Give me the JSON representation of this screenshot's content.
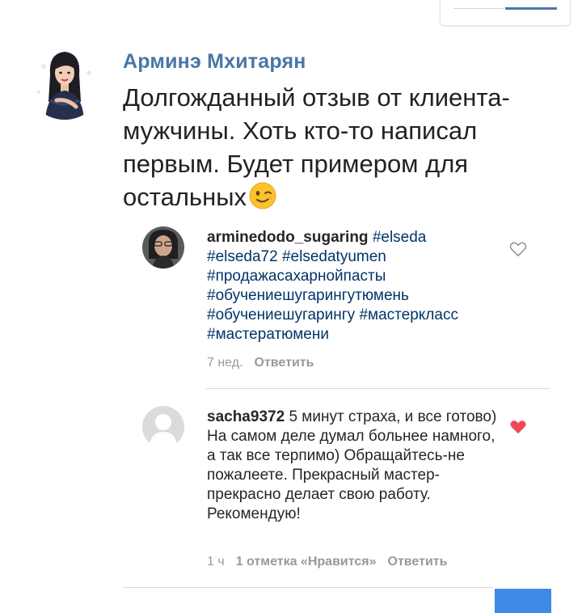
{
  "post": {
    "author": "Арминэ Мхитарян",
    "text": "Долгожданный отзыв от клиента-мужчины. Хоть кто-то написал первым. Будет примером для остальных",
    "emoji_icon": "winking-face-emoji"
  },
  "comments": [
    {
      "username": "arminedodo_sugaring",
      "hashtags": [
        "#elseda",
        "#elseda72",
        "#elsedatyumen",
        "#продажасахарнойпасты",
        "#обучениешугарингутюмень",
        "#обучениешугарингу",
        "#мастеркласс",
        "#мастератюмени"
      ],
      "time": "7 нед.",
      "reply_label": "Ответить",
      "liked": false
    },
    {
      "username": "sacha9372",
      "text": "5 минут страха, и все готово) На самом деле думал больнее  намного, а так все терпимо) Обращайтесь-не пожалеете. Прекрасный мастер-прекрасно делает свою работу. Рекомендую!",
      "time": "1 ч",
      "likes_label": "1 отметка «Нравится»",
      "reply_label": "Ответить",
      "liked": true
    }
  ],
  "colors": {
    "author": "#4a76a8",
    "hashtag": "#003569",
    "heart_liked": "#ed4956",
    "meta": "#999999",
    "accent_button": "#3d8ae6"
  }
}
